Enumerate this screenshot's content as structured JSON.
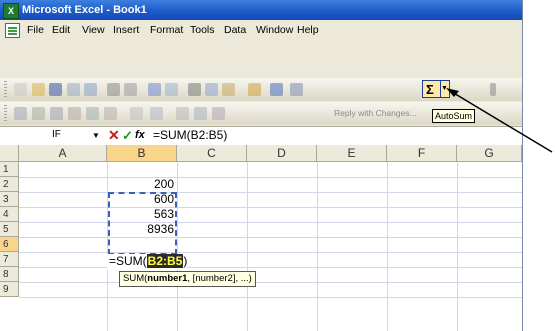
{
  "window": {
    "title": "Microsoft Excel - Book1"
  },
  "menu": {
    "items": [
      "File",
      "Edit",
      "View",
      "Insert",
      "Format",
      "Tools",
      "Data",
      "Window",
      "Help"
    ]
  },
  "toolbar": {
    "autosum_symbol": "Σ",
    "autosum_tooltip": "AutoSum",
    "reply_text": "Reply with Changes..."
  },
  "formula_bar": {
    "name_box": "IF",
    "cancel_symbol": "✕",
    "enter_symbol": "✓",
    "fx_symbol": "fx",
    "formula": "=SUM(B2:B5)"
  },
  "grid": {
    "columns": [
      "A",
      "B",
      "C",
      "D",
      "E",
      "F",
      "G"
    ],
    "rows": [
      "1",
      "2",
      "3",
      "4",
      "5",
      "6",
      "7",
      "8",
      "9"
    ],
    "b_values": [
      "200",
      "600",
      "563",
      "8936"
    ],
    "editing_text": "=SUM(",
    "editing_ref": "B2:B5",
    "editing_close": ")",
    "hint": {
      "func": "SUM(",
      "arg1": "number1",
      "rest": ", [number2], ...)"
    }
  },
  "colors": {
    "title": "#1c5bc9",
    "selection_header": "#f9d48b",
    "marquee": "#3b5fc0"
  }
}
